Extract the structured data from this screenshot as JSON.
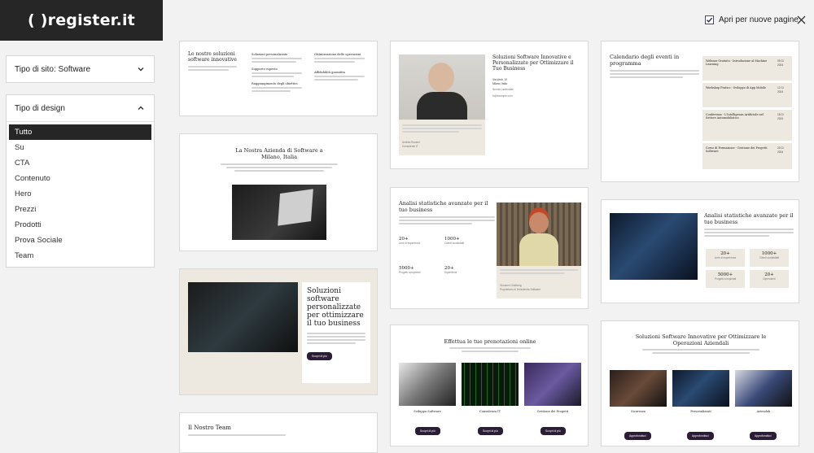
{
  "brand": {
    "logo": "( )register.it"
  },
  "filters": {
    "site_type": {
      "label": "Tipo di sito: Software"
    },
    "design_type": {
      "label": "Tipo di design",
      "items": [
        {
          "label": "Tutto",
          "selected": true
        },
        {
          "label": "Su",
          "selected": false
        },
        {
          "label": "CTA",
          "selected": false
        },
        {
          "label": "Contenuto",
          "selected": false
        },
        {
          "label": "Hero",
          "selected": false
        },
        {
          "label": "Prezzi",
          "selected": false
        },
        {
          "label": "Prodotti",
          "selected": false
        },
        {
          "label": "Prova Sociale",
          "selected": false
        },
        {
          "label": "Team",
          "selected": false
        }
      ]
    }
  },
  "topbar": {
    "open_new_pages": "Apri per nuove pagine",
    "checked": true
  },
  "cards": {
    "c1": {
      "title": "Le nostre soluzioni software innovative",
      "col2_a": "Soluzioni personalizzate",
      "col2_b": "Supporto esperto",
      "col2_c": "Raggiungimento degli obiettivi",
      "col3_a": "Ottimizzazione delle operazioni",
      "col3_b": "Affidabilità garantita"
    },
    "c2": {
      "title": "La Nostra Azienda di Software a Milano, Italia"
    },
    "c3": {
      "title": "Soluzioni software personalizzate per ottimizzare il tuo business",
      "button": "Scopri di più"
    },
    "c4": {
      "title": "Il Nostro Team"
    },
    "c5": {
      "title": "Soluzioni Software Innovative e Personalizzate per Ottimizzare il Tuo Business",
      "addr1": "Via Verdi, 10",
      "addr2": "Milano, Italia",
      "addr3": "Numero aziendale",
      "addr4": "hi@example.com",
      "caption_name": "Andrea Rossini",
      "caption_role": "Consulente IT"
    },
    "c6": {
      "title": "Analisi statistiche avanzate per il tuo business",
      "stats": [
        {
          "value": "20+",
          "label": "Anni di esperienza"
        },
        {
          "value": "1000+",
          "label": "Clienti soddisfatti"
        },
        {
          "value": "5000+",
          "label": "Progetti completati"
        },
        {
          "value": "20+",
          "label": "Dipendenti"
        }
      ],
      "quote_name": "Giovanni Goldberg",
      "quote_role": "Proprietario di Un'azienda Software"
    },
    "c7": {
      "title": "Effettua le tue prenotazioni online",
      "items": [
        "Sviluppo Software",
        "Consulenza IT",
        "Gestione dei Progetti"
      ],
      "button": "Scopri di più"
    },
    "c8": {
      "title": "Calendario degli eventi in programma",
      "events": [
        {
          "name": "Webinar Gratuito - Introduzione al Machine Learning",
          "date": "05 Gi 2024"
        },
        {
          "name": "Workshop Pratico - Sviluppo di App Mobile",
          "date": "12 Gi 2024"
        },
        {
          "name": "Conferenza - L'Intelligenza Artificiale nel Settore Automobilistico",
          "date": "18 Gi 2024"
        },
        {
          "name": "Corso di Formazione - Gestione dei Progetti Software",
          "date": "25 Gi 2024"
        }
      ]
    },
    "c9": {
      "title": "Analisi statistiche avanzate per il tuo business",
      "stats": [
        {
          "value": "20+",
          "label": "Anni di esperienza"
        },
        {
          "value": "1000+",
          "label": "Clienti soddisfatti"
        },
        {
          "value": "5000+",
          "label": "Progetti completati"
        },
        {
          "value": "20+",
          "label": "Dipendenti"
        }
      ]
    },
    "c10": {
      "title": "Soluzioni Software Innovative per Ottimizzare le Operazioni Aziendali",
      "items": [
        "Sicurezza",
        "Personalizzati",
        "Aziendali"
      ],
      "button": "Approfondisci"
    }
  }
}
